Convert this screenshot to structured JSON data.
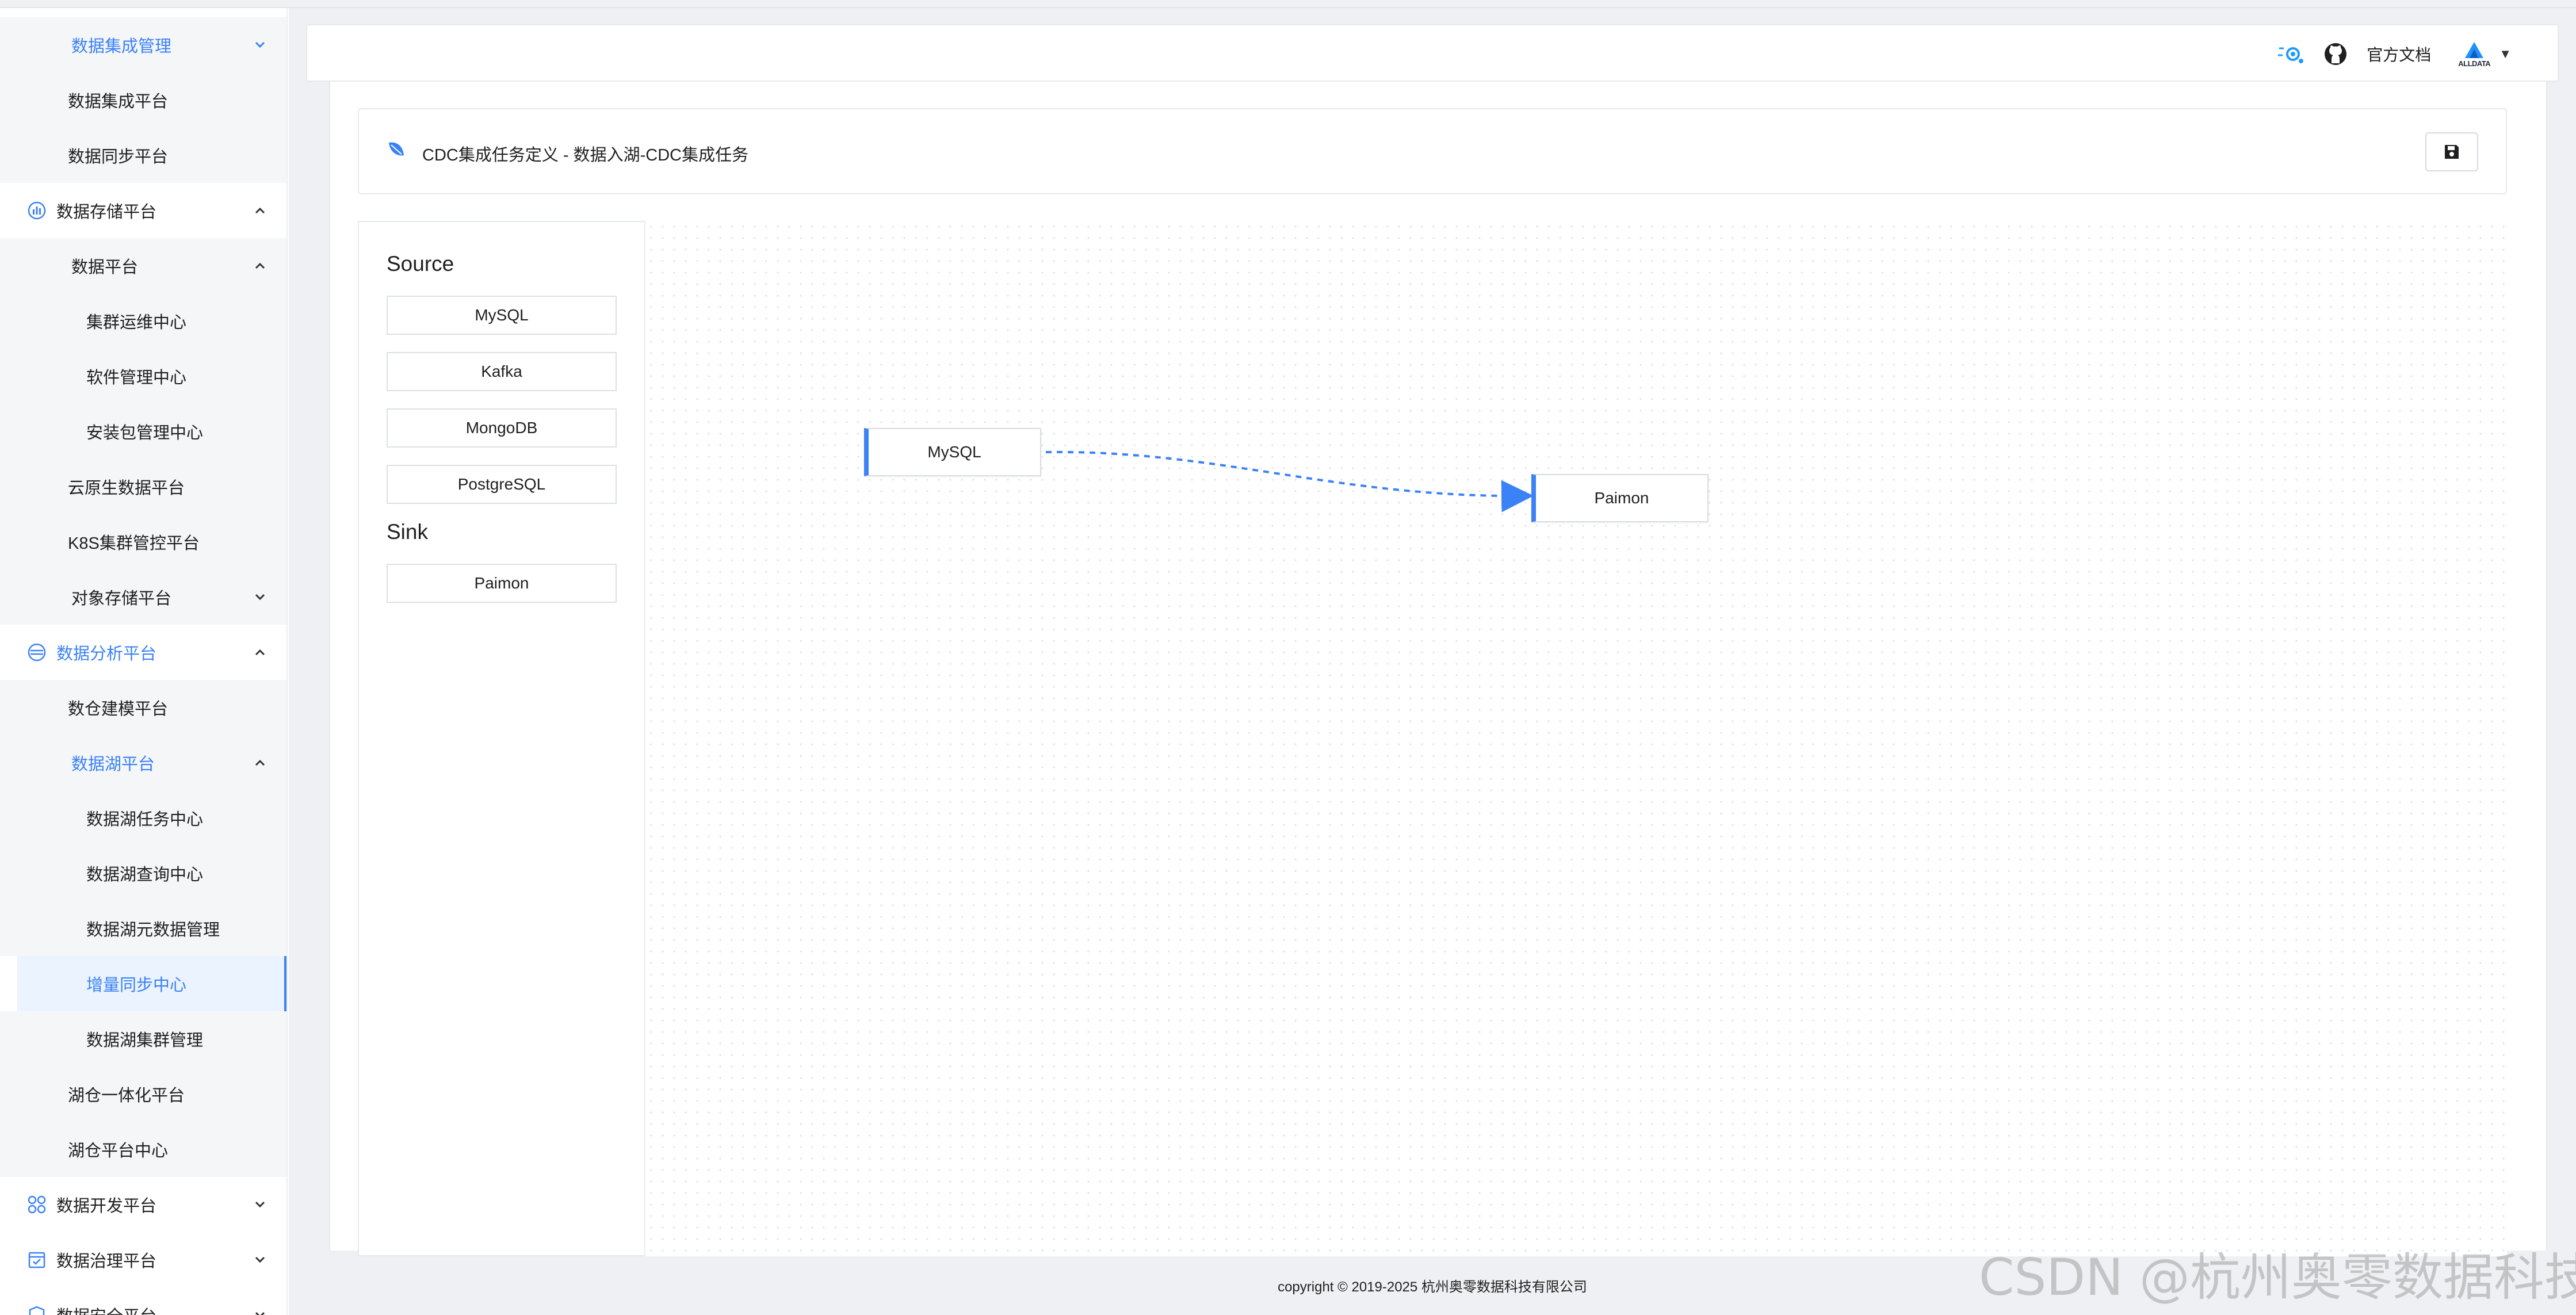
{
  "sidebar": {
    "items": [
      {
        "label": "数据集成管理",
        "chevron": "down"
      },
      {
        "label": "数据集成平台"
      },
      {
        "label": "数据同步平台"
      },
      {
        "label": "数据存储平台",
        "chevron": "up",
        "icon": "storage-chart-icon"
      },
      {
        "label": "数据平台",
        "chevron": "up"
      },
      {
        "label": "集群运维中心"
      },
      {
        "label": "软件管理中心"
      },
      {
        "label": "安装包管理中心"
      },
      {
        "label": "云原生数据平台"
      },
      {
        "label": "K8S集群管控平台"
      },
      {
        "label": "对象存储平台",
        "chevron": "down"
      },
      {
        "label": "数据分析平台",
        "chevron": "up",
        "icon": "analysis-icon"
      },
      {
        "label": "数仓建模平台"
      },
      {
        "label": "数据湖平台",
        "chevron": "up"
      },
      {
        "label": "数据湖任务中心"
      },
      {
        "label": "数据湖查询中心"
      },
      {
        "label": "数据湖元数据管理"
      },
      {
        "label": "增量同步中心"
      },
      {
        "label": "数据湖集群管理"
      },
      {
        "label": "湖仓一体化平台"
      },
      {
        "label": "湖仓平台中心"
      },
      {
        "label": "数据开发平台",
        "chevron": "down",
        "icon": "dev-icon"
      },
      {
        "label": "数据治理平台",
        "chevron": "down",
        "icon": "governance-icon"
      },
      {
        "label": "数据安全平台",
        "chevron": "down",
        "icon": "security-icon"
      }
    ]
  },
  "header": {
    "docs_label": "官方文档",
    "logo_text": "ALLDATA",
    "caret": "▼"
  },
  "task": {
    "title": "CDC集成任务定义 - 数据入湖-CDC集成任务"
  },
  "palette": {
    "source_heading": "Source",
    "sources": [
      "MySQL",
      "Kafka",
      "MongoDB",
      "PostgreSQL"
    ],
    "sink_heading": "Sink",
    "sinks": [
      "Paimon"
    ]
  },
  "canvas": {
    "nodes": [
      {
        "label": "MySQL"
      },
      {
        "label": "Paimon"
      }
    ],
    "edge_color": "#3b82f6"
  },
  "footer": {
    "copyright": "copyright © 2019-2025 杭州奥零数据科技有限公司"
  },
  "watermark": "CSDN @杭州奥零数据科技",
  "colors": {
    "accent": "#3b82f6",
    "sidebar_bg": "#f5f6f8",
    "main_bg": "#eef0f3"
  }
}
